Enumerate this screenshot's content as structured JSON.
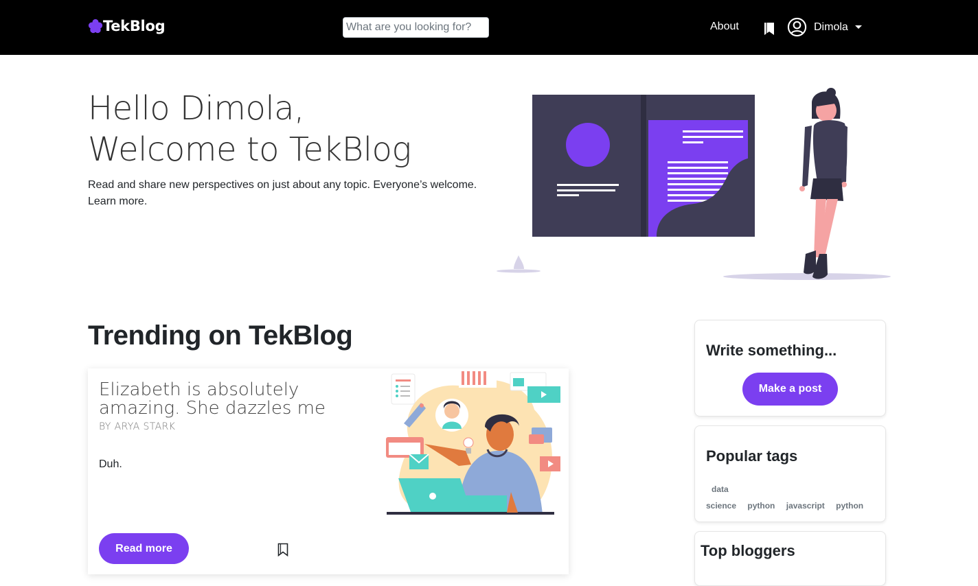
{
  "nav": {
    "brand": "TekBlog",
    "search_placeholder": "What are you looking for?",
    "about": "About",
    "username": "Dimola"
  },
  "hero": {
    "line1": "Hello Dimola,",
    "line2": "Welcome to TekBlog",
    "subtitle": "Read and share new perspectives on just about any topic. Everyone’s welcome. Learn more."
  },
  "trending": {
    "heading": "Trending on TekBlog",
    "post": {
      "title": "Elizabeth is absolutely amazing. She dazzles me",
      "author": "BY ARYA STARK",
      "excerpt": "Duh.",
      "read_more": "Read more"
    }
  },
  "sidebar": {
    "write_heading": "Write something...",
    "make_post": "Make a post",
    "tags_heading": "Popular tags",
    "tags": [
      "data",
      "science",
      "python",
      "javascript",
      "python"
    ],
    "bloggers_heading": "Top bloggers"
  },
  "colors": {
    "accent": "#7b3ff0",
    "navbar": "#000000",
    "illustration_dark": "#3f3d56"
  },
  "icons": [
    "flower-logo-icon",
    "bookmark-icon",
    "user-circle-icon",
    "caret-down-icon"
  ]
}
